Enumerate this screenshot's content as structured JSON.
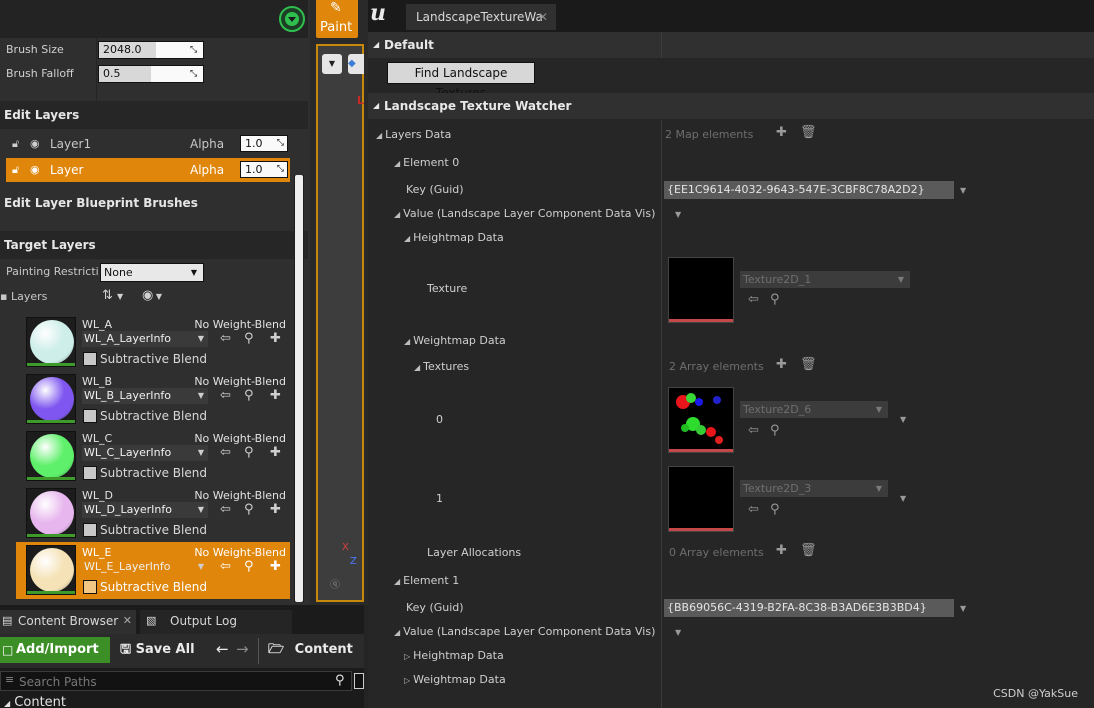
{
  "left": {
    "brush_size": {
      "label": "Brush Size",
      "value": "2048.0",
      "fill": 0.55
    },
    "brush_falloff": {
      "label": "Brush Falloff",
      "value": "0.5",
      "fill": 0.5
    },
    "edit_layers_title": "Edit Layers",
    "edit_layers": [
      {
        "name": "Layer1",
        "alpha_label": "Alpha",
        "alpha": "1.0",
        "selected": false
      },
      {
        "name": "Layer",
        "alpha_label": "Alpha",
        "alpha": "1.0",
        "selected": true
      }
    ],
    "blueprint_brushes_title": "Edit Layer Blueprint Brushes",
    "target_layers_title": "Target Layers",
    "painting_restriction_label": "Painting Restriction",
    "painting_restriction_value": "None",
    "layers_label": "Layers",
    "target_layers": [
      {
        "name": "WL_A",
        "blend": "No Weight-Blend",
        "info": "WL_A_LayerInfo",
        "sub": "Subtractive Blend",
        "color": "#cdeee9",
        "selected": false
      },
      {
        "name": "WL_B",
        "blend": "No Weight-Blend",
        "info": "WL_B_LayerInfo",
        "sub": "Subtractive Blend",
        "color": "#7f57f0",
        "selected": false
      },
      {
        "name": "WL_C",
        "blend": "No Weight-Blend",
        "info": "WL_C_LayerInfo",
        "sub": "Subtractive Blend",
        "color": "#5ef06a",
        "selected": false
      },
      {
        "name": "WL_D",
        "blend": "No Weight-Blend",
        "info": "WL_D_LayerInfo",
        "sub": "Subtractive Blend",
        "color": "#e7b6ee",
        "selected": false
      },
      {
        "name": "WL_E",
        "blend": "No Weight-Blend",
        "info": "WL_E_LayerInfo",
        "sub": "Subtractive Blend",
        "color": "#f5e2b6",
        "selected": true
      }
    ]
  },
  "viewport": {
    "paint_label": "Paint",
    "axis_x": "X",
    "axis_z": "Z"
  },
  "bottom": {
    "tab_content_browser": "Content Browser",
    "tab_output_log": "Output Log",
    "add_import": "Add/Import",
    "save_all": "Save All",
    "content": "Content",
    "search_placeholder": "Search Paths",
    "tree_content": "Content"
  },
  "right": {
    "tab_title": "LandscapeTextureWa",
    "cat_default": "Default",
    "find_button": "Find Landscape Textures",
    "cat_watcher": "Landscape Texture Watcher",
    "layers_data": "Layers Data",
    "map_elements": "2 Map elements",
    "element0": "Element 0",
    "key_guid": "Key (Guid)",
    "guid0": "{EE1C9614-4032-9643-547E-3CBF8C78A2D2}",
    "value_label": "Value (Landscape Layer Component Data Vis)",
    "heightmap_data": "Heightmap Data",
    "texture_label": "Texture",
    "tex_height": "Texture2D_1",
    "weightmap_data": "Weightmap Data",
    "textures_label": "Textures",
    "array_elements": "2 Array elements",
    "idx0": "0",
    "tex_w0": "Texture2D_6",
    "idx1": "1",
    "tex_w1": "Texture2D_3",
    "layer_alloc": "Layer Allocations",
    "zero_elements": "0 Array elements",
    "element1": "Element 1",
    "guid1": "{BB69056C-4319-B2FA-8C38-B3AD6E3B3BD4}",
    "heightmap_data2": "Heightmap Data",
    "weightmap_data2": "Weightmap Data"
  },
  "watermark": "CSDN @YakSue",
  "colors": {
    "accent": "#e0860a",
    "panel": "#2f2f2f",
    "background": "#242424"
  }
}
